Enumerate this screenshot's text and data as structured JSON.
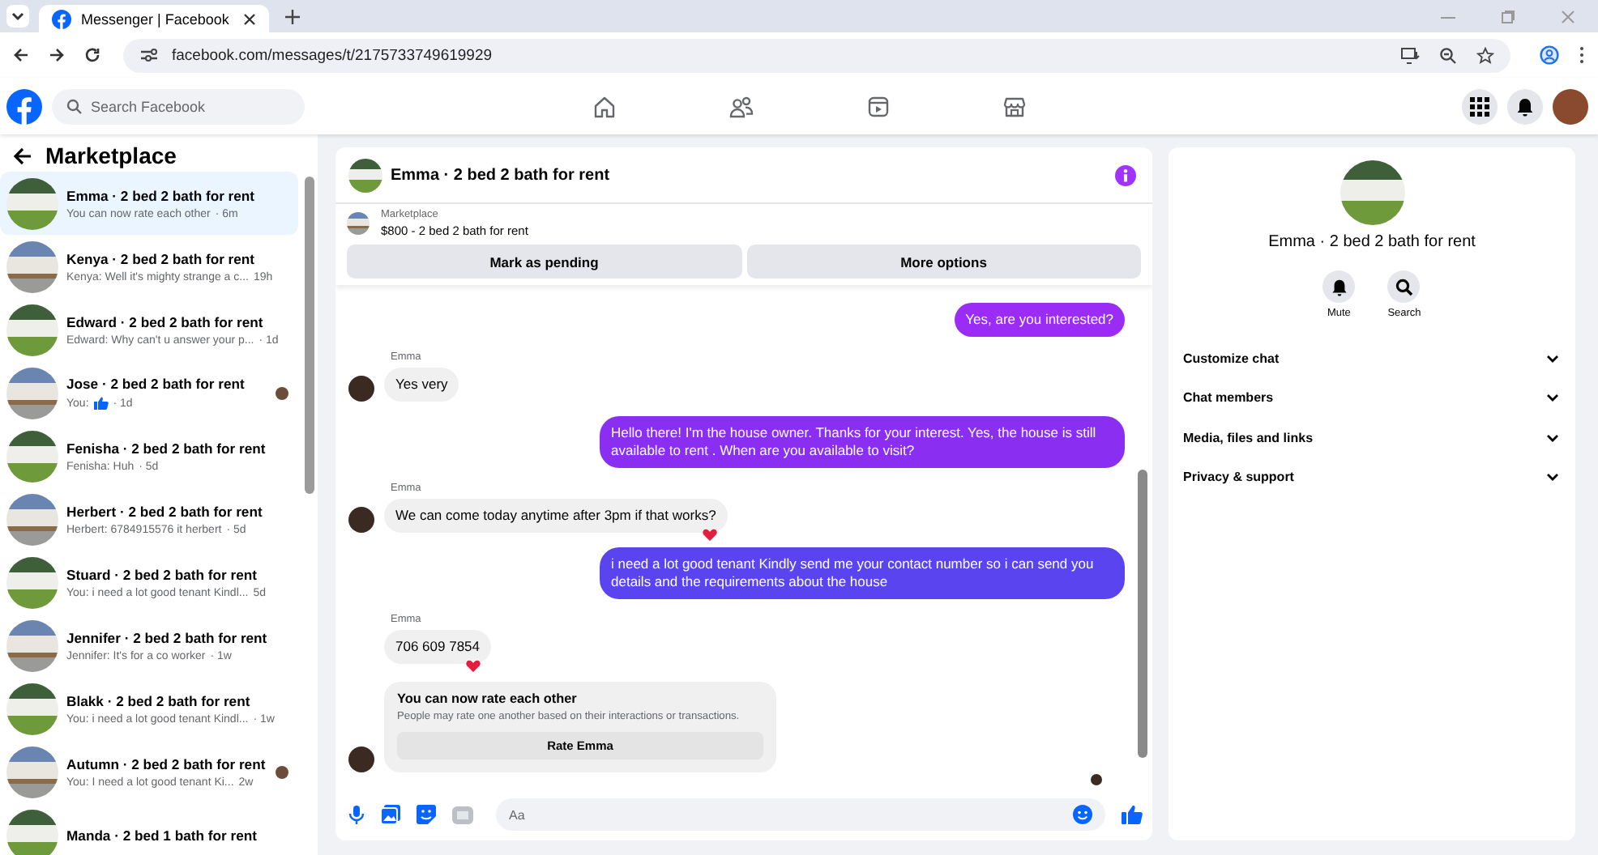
{
  "browser": {
    "tab_title": "Messenger | Facebook",
    "url": "facebook.com/messages/t/2175733749619929"
  },
  "topnav": {
    "search_placeholder": "Search Facebook"
  },
  "sidebar": {
    "title": "Marketplace",
    "conversations": [
      {
        "name": "Emma · 2 bed 2 bath for rent",
        "preview": "You can now rate each other",
        "time": "· 6m",
        "selected": true,
        "kind": "text",
        "seen": false
      },
      {
        "name": "Kenya · 2 bed 2 bath for rent",
        "preview": "Kenya: Well it's mighty strange a c...",
        "time": "19h",
        "selected": false,
        "kind": "text",
        "seen": false
      },
      {
        "name": "Edward · 2 bed 2 bath for rent",
        "preview": "Edward: Why can't u answer your p...",
        "time": "· 1d",
        "selected": false,
        "kind": "text",
        "seen": false
      },
      {
        "name": "Jose · 2 bed 2 bath for rent",
        "preview": "You:",
        "time": "· 1d",
        "selected": false,
        "kind": "like",
        "seen": true
      },
      {
        "name": "Fenisha · 2 bed 2 bath for rent",
        "preview": "Fenisha: Huh",
        "time": "· 5d",
        "selected": false,
        "kind": "text",
        "seen": false
      },
      {
        "name": "Herbert · 2 bed 2 bath for rent",
        "preview": "Herbert: 6784915576 it herbert",
        "time": "· 5d",
        "selected": false,
        "kind": "text",
        "seen": false
      },
      {
        "name": "Stuard · 2 bed 2 bath for rent",
        "preview": "You: i need a lot good tenant Kindl...",
        "time": "5d",
        "selected": false,
        "kind": "text",
        "seen": false
      },
      {
        "name": "Jennifer · 2 bed 2 bath for rent",
        "preview": "Jennifer: It's for a co worker",
        "time": "· 1w",
        "selected": false,
        "kind": "text",
        "seen": false
      },
      {
        "name": "Blakk · 2 bed 2 bath for rent",
        "preview": "You: i need a lot good tenant Kindl...",
        "time": "· 1w",
        "selected": false,
        "kind": "text",
        "seen": false
      },
      {
        "name": "Autumn · 2 bed 2 bath for rent",
        "preview": "You: I need a lot good tenant Ki...",
        "time": "2w",
        "selected": false,
        "kind": "text",
        "seen": true
      },
      {
        "name": "Manda · 2 bed 1 bath for rent",
        "selected": false,
        "seen": false
      }
    ]
  },
  "chat": {
    "title": "Emma · 2 bed 2 bath for rent",
    "listing_label": "Marketplace",
    "listing": "$800 - 2 bed 2 bath for rent",
    "actions": [
      "Mark as pending",
      "More options"
    ],
    "messages": [
      {
        "kind": "sent",
        "text": "Yes, are you interested?",
        "color": "#9b2cf5"
      },
      {
        "kind": "received",
        "sender": "Emma",
        "text": "Yes very",
        "reaction": false,
        "avatar": true
      },
      {
        "kind": "sent",
        "text": "Hello there! I'm the house owner. Thanks for your interest. Yes, the house is still available to rent . When are you available to visit?",
        "color": "#8a2ef2"
      },
      {
        "kind": "received",
        "sender": "Emma",
        "text": "We can come today anytime after 3pm if that works?",
        "reaction": true,
        "avatar": true
      },
      {
        "kind": "sent",
        "text": "i need a lot good tenant Kindly send me your contact number so i can send you details and the requirements about the house",
        "color": "#5a44f0"
      },
      {
        "kind": "received",
        "sender": "Emma",
        "text": "706 609 7854",
        "reaction": true,
        "avatar": false
      },
      {
        "kind": "rating",
        "title": "You can now rate each other",
        "text": "People may rate one another based on their interactions or transactions.",
        "button": "Rate Emma",
        "avatar": true
      }
    ],
    "composer_placeholder": "Aa"
  },
  "details": {
    "name": "Emma · 2 bed 2 bath for rent",
    "actions": [
      {
        "label": "Mute",
        "kind": "bell"
      },
      {
        "label": "Search",
        "kind": "search"
      }
    ],
    "sections": [
      {
        "label": "Customize chat",
        "expanded": false
      },
      {
        "label": "Chat members",
        "expanded": false
      },
      {
        "label": "Media, files and links",
        "expanded": false
      },
      {
        "label": "Privacy & support",
        "expanded": false
      }
    ]
  }
}
